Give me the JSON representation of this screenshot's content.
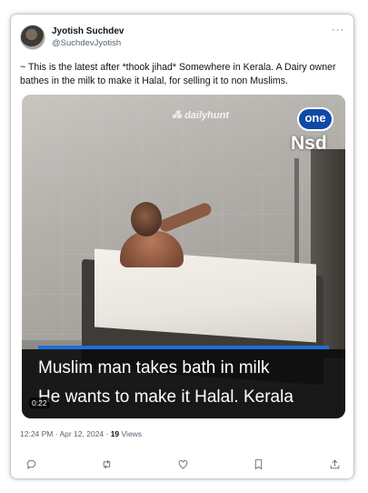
{
  "tweet": {
    "author_name": "Jyotish Suchdev",
    "author_handle": "@SuchdevJyotish",
    "more_label": "···",
    "text": "~ This is the latest after *thook jihad*   Somewhere in Kerala. A Dairy owner bathes in the milk to make it Halal, for selling it to non Muslims.",
    "timestamp": "12:24 PM · Apr 12, 2024 · ",
    "views_count": "19",
    "views_label": " Views"
  },
  "video": {
    "watermark": "dailyhunt",
    "channel_logo": "one",
    "channel_name": "Nsd",
    "caption_line1": "Muslim man takes bath in milk",
    "caption_line2": "He wants to make it Halal. Kerala",
    "duration": "0:22"
  },
  "actions": {
    "icons": [
      "reply-icon",
      "retweet-icon",
      "like-icon",
      "bookmark-icon",
      "share-icon"
    ]
  },
  "colors": {
    "accent": "#1f6fd6",
    "secondary_text": "#536471",
    "channel_logo": "#0e4aa8"
  }
}
